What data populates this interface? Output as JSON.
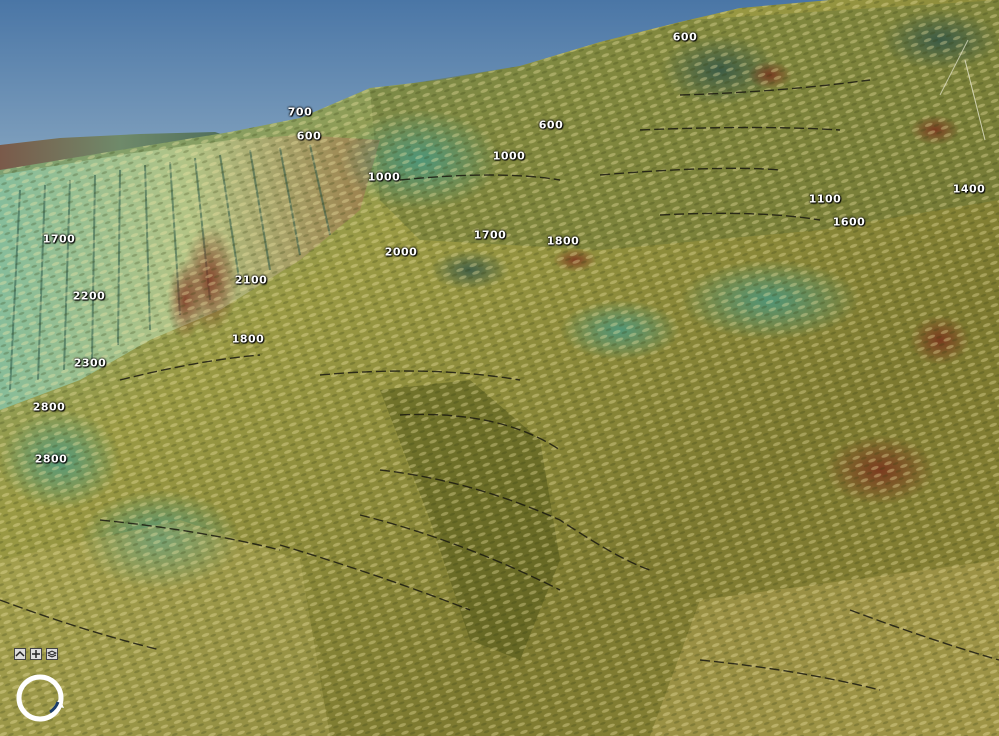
{
  "map": {
    "contour_labels": [
      {
        "text": "600"
      },
      {
        "text": "700"
      },
      {
        "text": "600"
      },
      {
        "text": "600"
      },
      {
        "text": "1000"
      },
      {
        "text": "1000"
      },
      {
        "text": "1100"
      },
      {
        "text": "1400"
      },
      {
        "text": "1600"
      },
      {
        "text": "1700"
      },
      {
        "text": "1700"
      },
      {
        "text": "1800"
      },
      {
        "text": "2000"
      },
      {
        "text": "2100"
      },
      {
        "text": "2200"
      },
      {
        "text": "1800"
      },
      {
        "text": "2300"
      },
      {
        "text": "2800"
      },
      {
        "text": "2800"
      }
    ]
  },
  "controls": {
    "icons": [
      "zoom-in-icon",
      "pan-icon",
      "layers-icon"
    ],
    "rotate_icon": "rotate-icon"
  },
  "colors": {
    "sky_top": "#4f79a8",
    "sky_bottom": "#9cb6c9",
    "terrain_olive": "#8a8a3a",
    "terrain_teal": "#4f9a86",
    "terrain_rust": "#8a3a2a"
  }
}
